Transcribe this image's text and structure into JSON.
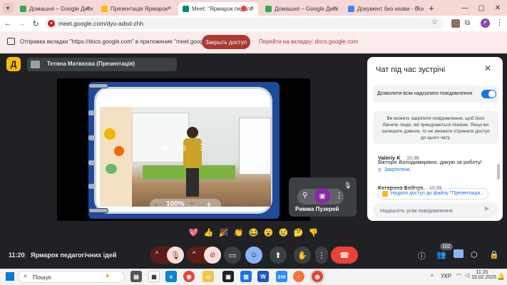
{
  "tabs": [
    {
      "label": "Домашня – Google Диск",
      "color": "#34a853"
    },
    {
      "label": "Презентація Ярмарок",
      "color": "#fbbc04"
    },
    {
      "label": "Meet: \"Ярмарок педаго",
      "color": "#00897b"
    },
    {
      "label": "Домашня – Google Диск",
      "color": "#34a853"
    },
    {
      "label": "Документ без назви - Goo",
      "color": "#4285f4"
    }
  ],
  "address": {
    "url": "meet.google.com/dyu-adsd-zhh"
  },
  "infobar": {
    "message": "Отправка вкладки \"https://docs.google.com\" в приложение \"meet.google.com\"...",
    "stop_label": "Закрыть доступ",
    "switch_label": "Перейти на вкладку: docs.google.com"
  },
  "presenter": {
    "initial": "Д",
    "name": "Тетяна Матвєєва (Презентація)"
  },
  "slide": {
    "zoom": "100%"
  },
  "self_tile": {
    "name": "Римма Пузерей"
  },
  "bottom": {
    "time": "11:20",
    "meeting_name": "Ярмарок педагогічних ідей",
    "participants_badge": "102"
  },
  "chat": {
    "title": "Чат під час зустрічі",
    "toggle_label": "Дозволити всім надсилати повідомлення",
    "info": "Ви можете закріпити повідомлення, щоб його бачили люди, які приєднаються пізніше. Якщо ви залишите дзвінок, то не зможете отримати доступ до цього чату.",
    "messages": [
      {
        "author": "Valeriy K",
        "time": "10:38",
        "text": "Вікторіє Володимирівно, дякую за роботу!",
        "pinned": "Закріплено"
      },
      {
        "author": "Катерина Бойчук",
        "time": "10:38",
        "attachment": "Надати доступ до файлу \"Презентація..."
      }
    ],
    "input_placeholder": "Надішліть усім повідомлення"
  },
  "taskbar": {
    "search": "Пошук",
    "lang": "УКР",
    "time": "11:20",
    "date": "18.02.2025"
  },
  "colors": {
    "accent": "#1a73e8",
    "danger": "#ea4335",
    "stop_button": "#a83a32"
  }
}
